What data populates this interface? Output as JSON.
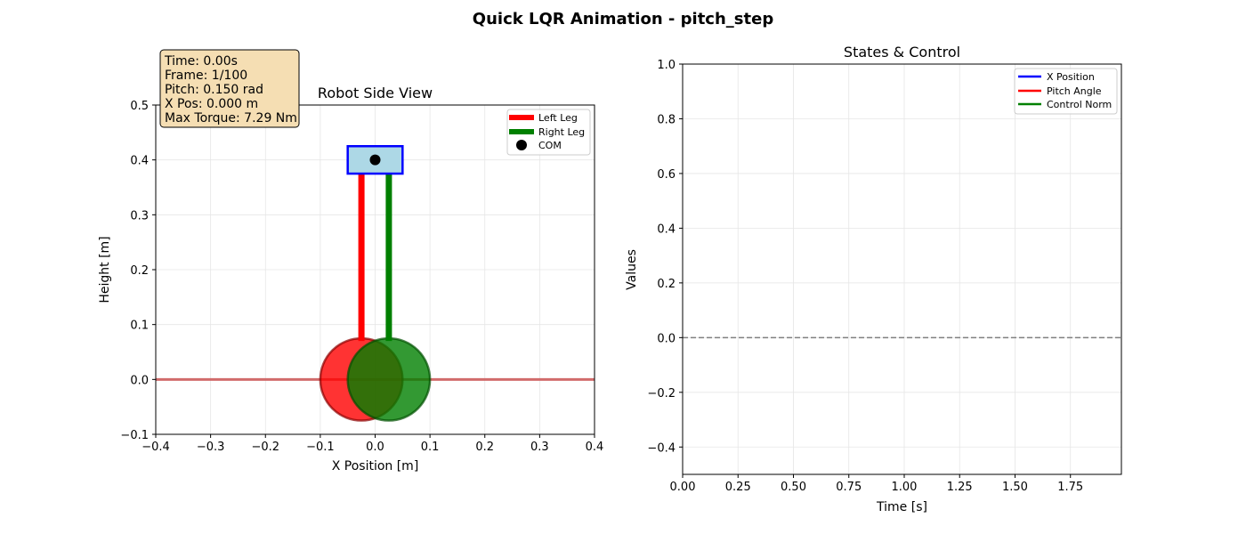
{
  "figure": {
    "suptitle": "Quick LQR Animation - pitch_step"
  },
  "info_box": {
    "time": "Time: 0.00s",
    "frame": "Frame: 1/100",
    "pitch": "Pitch: 0.150 rad",
    "x_pos": "X Pos: 0.000 m",
    "max_torque": "Max Torque: 7.29 Nm"
  },
  "colors": {
    "left_leg": "#ff0000",
    "right_leg": "#008000",
    "body_fill": "#add8e6",
    "body_edge": "#0000ff",
    "com": "#000000",
    "ground": "#cd5c5c",
    "x_position": "#0000ff",
    "pitch_angle": "#ff0000",
    "control_norm": "#008000",
    "zero_line": "#808080"
  },
  "chart_data": [
    {
      "type": "scatter",
      "title": "Robot Side View",
      "xlabel": "X Position [m]",
      "ylabel": "Height [m]",
      "xlim": [
        -0.4,
        0.4
      ],
      "ylim": [
        -0.1,
        0.5
      ],
      "xticks": [
        -0.4,
        -0.3,
        -0.2,
        -0.1,
        0.0,
        0.1,
        0.2,
        0.3,
        0.4
      ],
      "xtick_labels": [
        "−0.4",
        "−0.3",
        "−0.2",
        "−0.1",
        "0.0",
        "0.1",
        "0.2",
        "0.3",
        "0.4"
      ],
      "yticks": [
        -0.1,
        0.0,
        0.1,
        0.2,
        0.3,
        0.4,
        0.5
      ],
      "ytick_labels": [
        "−0.1",
        "0.0",
        "0.1",
        "0.2",
        "0.3",
        "0.4",
        "0.5"
      ],
      "grid": true,
      "legend_position": "top-right",
      "legend": [
        "Left Leg",
        "Right Leg",
        "COM"
      ],
      "ground_y": 0.0,
      "body": {
        "x": [
          -0.05,
          0.05
        ],
        "y": [
          0.375,
          0.425
        ]
      },
      "com": {
        "x": 0.0,
        "y": 0.4
      },
      "left_leg": {
        "x": [
          -0.025,
          -0.025
        ],
        "y": [
          0.38,
          0.07
        ]
      },
      "right_leg": {
        "x": [
          0.025,
          0.025
        ],
        "y": [
          0.38,
          0.07
        ]
      },
      "left_wheel": {
        "cx": -0.025,
        "cy": 0.0,
        "r": 0.075
      },
      "right_wheel": {
        "cx": 0.025,
        "cy": 0.0,
        "r": 0.075
      }
    },
    {
      "type": "line",
      "title": "States & Control",
      "xlabel": "Time [s]",
      "ylabel": "Values",
      "xlim": [
        0.0,
        1.98
      ],
      "ylim": [
        -0.5,
        1.0
      ],
      "xticks": [
        0.0,
        0.25,
        0.5,
        0.75,
        1.0,
        1.25,
        1.5,
        1.75
      ],
      "xtick_labels": [
        "0.00",
        "0.25",
        "0.50",
        "0.75",
        "1.00",
        "1.25",
        "1.50",
        "1.75"
      ],
      "yticks": [
        -0.4,
        -0.2,
        0.0,
        0.2,
        0.4,
        0.6,
        0.8,
        1.0
      ],
      "ytick_labels": [
        "−0.4",
        "−0.2",
        "0.0",
        "0.2",
        "0.4",
        "0.6",
        "0.8",
        "1.0"
      ],
      "grid": true,
      "legend_position": "top-right",
      "zero_line": 0.0,
      "series": [
        {
          "name": "X Position",
          "x": [],
          "values": []
        },
        {
          "name": "Pitch Angle",
          "x": [],
          "values": []
        },
        {
          "name": "Control Norm",
          "x": [],
          "values": []
        }
      ]
    }
  ]
}
